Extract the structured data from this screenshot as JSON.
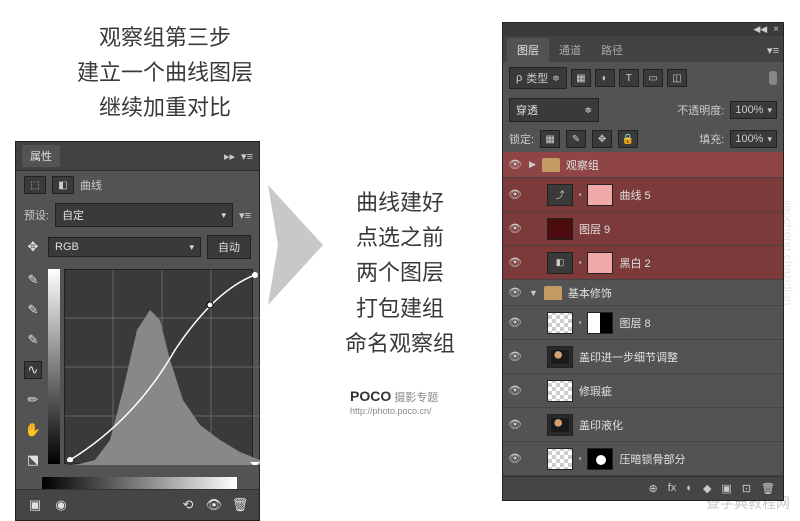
{
  "instructions": {
    "top": "观察组第三步\n建立一个曲线图层\n继续加重对比",
    "mid": "曲线建好\n点选之前\n两个图层\n打包建组\n命名观察组"
  },
  "poco": {
    "brand": "POCO",
    "tag": "摄影专题",
    "url": "http://photo.poco.cn/"
  },
  "watermarks": {
    "bottom": "查字典教程网",
    "side": "jiaocheng.chazidian"
  },
  "props_panel": {
    "tab": "属性",
    "type_label": "曲线",
    "preset_label": "预设:",
    "preset_value": "自定",
    "channel_value": "RGB",
    "auto_btn": "自动"
  },
  "layers_panel": {
    "tabs": [
      "图层",
      "通道",
      "路径"
    ],
    "kind_icon": "ρ",
    "kind_label": "类型",
    "blend_mode": "穿透",
    "opacity_label": "不透明度:",
    "opacity_value": "100%",
    "lock_label": "锁定:",
    "fill_label": "填充:",
    "fill_value": "100%",
    "layers": [
      {
        "type": "group",
        "name": "观察组",
        "highlight": true,
        "sel": true
      },
      {
        "type": "adj",
        "icon": "curves",
        "name": "曲线 5",
        "highlight": true,
        "indent": 1,
        "thumb": "pink"
      },
      {
        "type": "layer",
        "name": "图层 9",
        "highlight": true,
        "indent": 1,
        "thumb": "darkred"
      },
      {
        "type": "adj",
        "icon": "bw",
        "name": "黑白 2",
        "highlight": true,
        "indent": 1,
        "thumb": "pink"
      },
      {
        "type": "group",
        "name": "基本修饰",
        "open": true
      },
      {
        "type": "layer",
        "name": "图层 8",
        "indent": 1,
        "thumb": "checker",
        "mask": "halfblack"
      },
      {
        "type": "layer",
        "name": "盖印进一步细节调整",
        "indent": 1,
        "thumb": "photo"
      },
      {
        "type": "layer",
        "name": "修瑕疵",
        "indent": 1,
        "thumb": "checker"
      },
      {
        "type": "layer",
        "name": "盖印液化",
        "indent": 1,
        "thumb": "photo"
      },
      {
        "type": "layer",
        "name": "压暗锁骨部分",
        "indent": 1,
        "thumb": "checker",
        "mask": "blackdot"
      }
    ],
    "footer_icons": [
      "⊕",
      "fx",
      "◐",
      "◆",
      "▣",
      "⊡",
      "🗑"
    ]
  }
}
